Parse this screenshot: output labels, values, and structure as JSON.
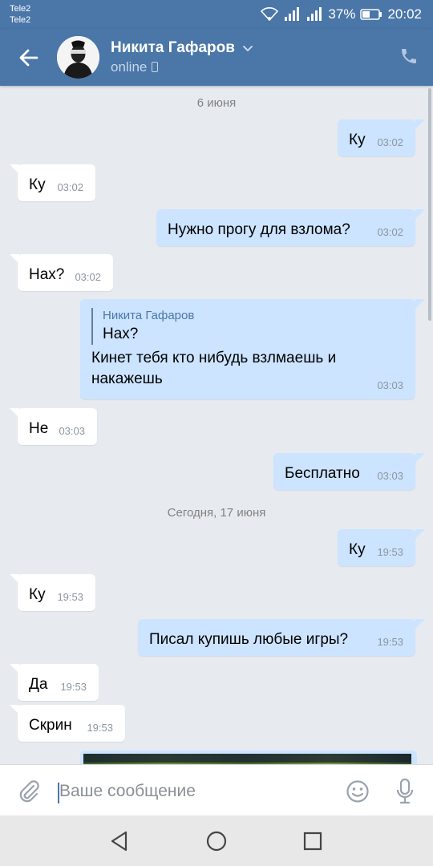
{
  "status_bar": {
    "carrier_1": "Tele2",
    "carrier_2": "Tele2",
    "battery": "37%",
    "time": "20:02"
  },
  "header": {
    "contact_name": "Никита Гафаров",
    "status": "online"
  },
  "colors": {
    "header_bg": "#4a76a8",
    "chat_bg": "#e7ebf0",
    "incoming_bubble": "#ffffff",
    "outgoing_bubble": "#cce4ff"
  },
  "chat": {
    "date_1": "6 июня",
    "date_2": "Сегодня, 17 июня",
    "messages": [
      {
        "dir": "out",
        "text": "Ку",
        "time": "03:02"
      },
      {
        "dir": "in",
        "text": "Ку",
        "time": "03:02"
      },
      {
        "dir": "out",
        "text": "Нужно прогу для взлома?",
        "time": "03:02"
      },
      {
        "dir": "in",
        "text": "Нах?",
        "time": "03:02"
      },
      {
        "dir": "out",
        "reply_name": "Никита Гафаров",
        "reply_text": "Нах?",
        "text_line1": "Кинет тебя кто нибудь взлмаешь и",
        "text_line2": "накажешь",
        "time": "03:03"
      },
      {
        "dir": "in",
        "text": "Не",
        "time": "03:03"
      },
      {
        "dir": "out",
        "text": "Бесплатно",
        "time": "03:03"
      },
      {
        "dir": "out",
        "text": "Ку",
        "time": "19:53"
      },
      {
        "dir": "in",
        "text": "Ку",
        "time": "19:53"
      },
      {
        "dir": "out",
        "text": "Писал купишь любые игры?",
        "time": "19:53"
      },
      {
        "dir": "in",
        "text": "Да",
        "time": "19:53"
      },
      {
        "dir": "in",
        "text": "Скрин",
        "time": "19:53"
      }
    ]
  },
  "input": {
    "placeholder": "Ваше сообщение"
  },
  "icons": [
    "back-arrow-icon",
    "chevron-down-icon",
    "phone-icon",
    "paperclip-icon",
    "emoji-icon",
    "microphone-icon",
    "nav-back-icon",
    "nav-home-icon",
    "nav-recents-icon"
  ]
}
